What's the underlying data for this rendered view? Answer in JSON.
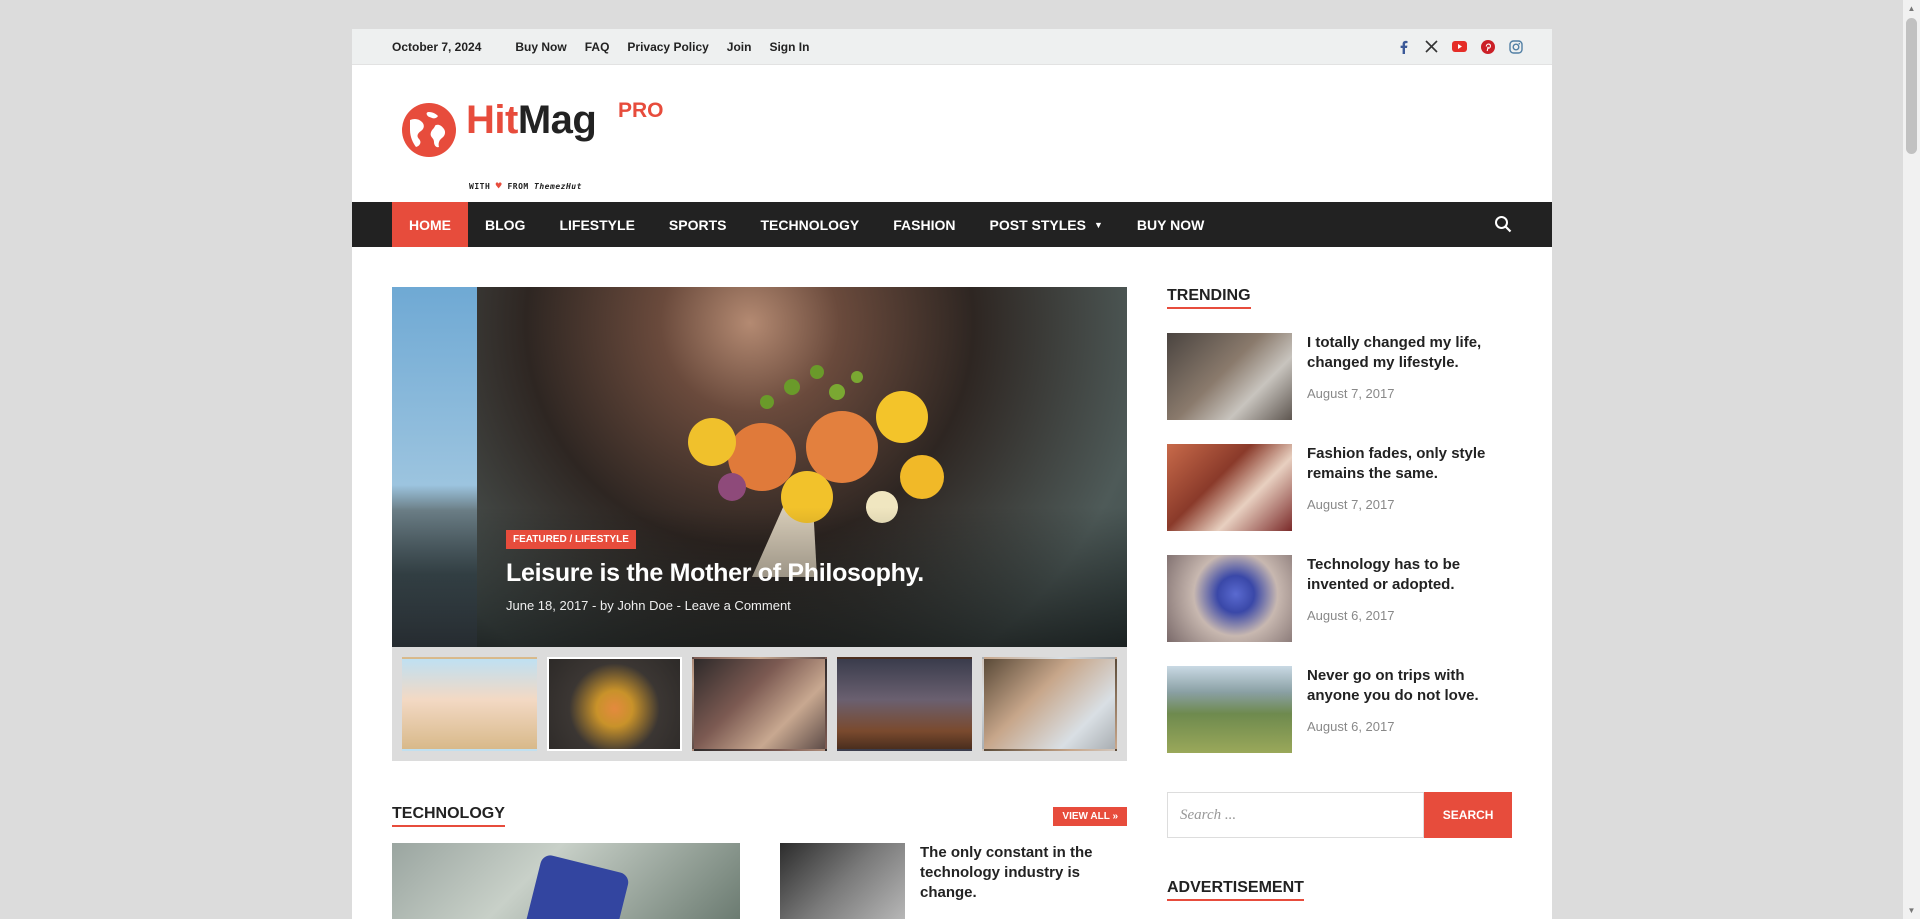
{
  "topbar": {
    "date": "October 7, 2024",
    "links": [
      "Buy Now",
      "FAQ",
      "Privacy Policy",
      "Join",
      "Sign In"
    ],
    "social": [
      {
        "name": "facebook-icon",
        "glyph": "f",
        "color": "#3b5998"
      },
      {
        "name": "x-icon",
        "glyph": "𝕏",
        "color": "#222222"
      },
      {
        "name": "youtube-icon",
        "glyph": "▶",
        "color": "#e52d27"
      },
      {
        "name": "pinterest-icon",
        "glyph": "P",
        "color": "#cb2027"
      },
      {
        "name": "instagram-icon",
        "glyph": "◎",
        "color": "#517fa4"
      }
    ]
  },
  "logo": {
    "hit": "Hit",
    "mag": "Mag",
    "pro": "PRO",
    "tag_with": "WITH",
    "tag_from": "FROM",
    "tag_brand": "ThemezHut"
  },
  "nav": {
    "items": [
      "Home",
      "Blog",
      "Lifestyle",
      "Sports",
      "Technology",
      "Fashion",
      "Post Styles",
      "Buy Now"
    ],
    "active": "Home"
  },
  "slider": {
    "category": "Featured / Lifestyle",
    "title": "Leisure is the Mother of Philosophy.",
    "date": "June 18, 2017",
    "author": "by John Doe",
    "comments": "Leave a Comment"
  },
  "technology": {
    "title": "Technology",
    "view_all": "View All",
    "post_title": "The only constant in the technology industry is change."
  },
  "trending": {
    "title": "Trending",
    "items": [
      {
        "title": "I totally changed my life, changed my lifestyle.",
        "date": "August 7, 2017"
      },
      {
        "title": "Fashion fades, only style remains the same.",
        "date": "August 7, 2017"
      },
      {
        "title": "Technology has to be invented or adopted.",
        "date": "August 6, 2017"
      },
      {
        "title": "Never go on trips with anyone you do not love.",
        "date": "August 6, 2017"
      }
    ]
  },
  "search": {
    "placeholder": "Search ...",
    "button": "Search"
  },
  "advertisement": {
    "title": "Advertisement"
  },
  "colors": {
    "accent": "#e74c3c",
    "nav_bg": "#222222"
  }
}
